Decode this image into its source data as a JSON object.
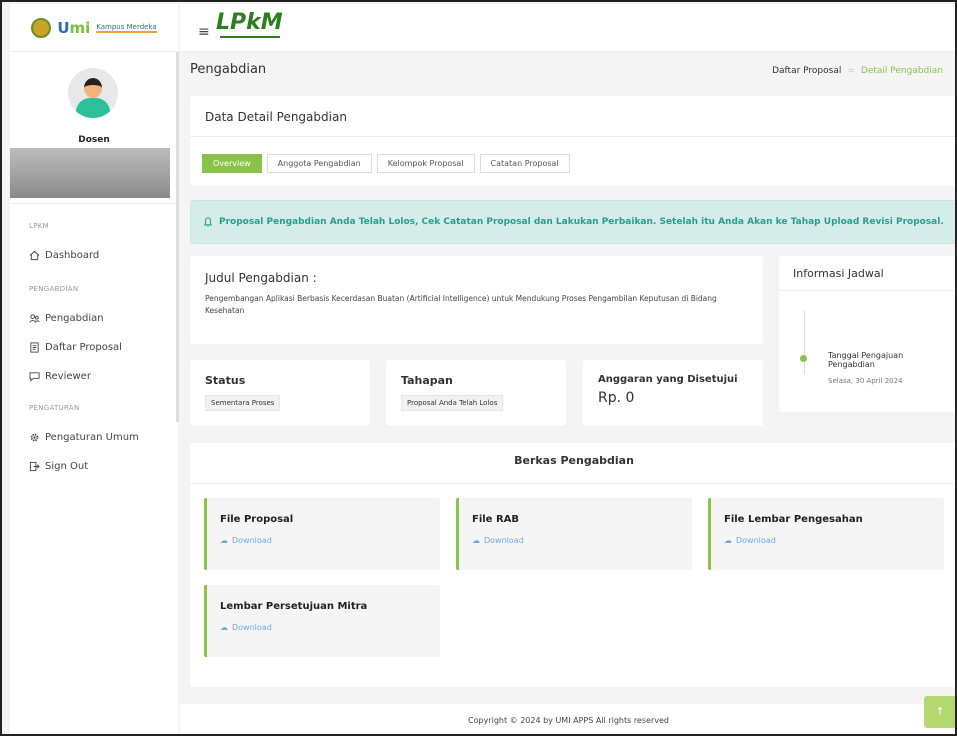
{
  "sidebar": {
    "logo_text_u": "U",
    "logo_text_mi": "mi",
    "logo_sub": "Kampus Merdeka",
    "role": "Dosen",
    "sections": [
      {
        "title": "LPKM",
        "items": [
          {
            "label": "Dashboard",
            "icon": "home-icon"
          }
        ]
      },
      {
        "title": "PENGABDIAN",
        "items": [
          {
            "label": "Pengabdian",
            "icon": "people-icon"
          },
          {
            "label": "Daftar Proposal",
            "icon": "document-icon"
          },
          {
            "label": "Reviewer",
            "icon": "chat-icon"
          }
        ]
      },
      {
        "title": "PENGATURAN",
        "items": [
          {
            "label": "Pengaturan Umum",
            "icon": "gear-icon"
          },
          {
            "label": "Sign Out",
            "icon": "sign-out-icon"
          }
        ]
      }
    ]
  },
  "header": {
    "brand": "LPkM",
    "menu_icon": "≡"
  },
  "page": {
    "title": "Pengabdian",
    "breadcrumb": {
      "parent": "Daftar Proposal",
      "separator": "=",
      "current": "Detail Pengabdian"
    }
  },
  "detail": {
    "card_title": "Data Detail Pengabdian",
    "tabs": [
      "Overview",
      "Anggota Pengabdian",
      "Kelompok Proposal",
      "Catatan Proposal"
    ]
  },
  "alert": {
    "text": "Proposal Pengabdian Anda Telah Lolos, Cek Catatan Proposal dan Lakukan Perbaikan. Setelah itu Anda Akan ke Tahap Upload Revisi Proposal."
  },
  "judul": {
    "label": "Judul Pengabdian :",
    "text": "Pengembangan Aplikasi Berbasis Kecerdasan Buatan (Artificial Intelligence) untuk Mendukung Proses Pengambilan Keputusan di Bidang Kesehatan"
  },
  "jadwal": {
    "title": "Informasi Jadwal",
    "event": "Tanggal Pengajuan Pengabdian",
    "date": "Selasa, 30 April 2024"
  },
  "status": {
    "label": "Status",
    "value": "Sementara Proses"
  },
  "tahapan": {
    "label": "Tahapan",
    "value": "Proposal Anda Telah Lolos"
  },
  "anggaran": {
    "label": "Anggaran yang Disetujui",
    "value": "Rp. 0"
  },
  "berkas": {
    "title": "Berkas Pengabdian",
    "download_label": "Download",
    "files": [
      "File Proposal",
      "File RAB",
      "File Lembar Pengesahan",
      "Lembar Persetujuan Mitra"
    ]
  },
  "footer": {
    "text": "Copyright © 2024 by UMI APPS All rights reserved",
    "top_icon": "↑"
  },
  "colors": {
    "accent": "#8bc34a",
    "alert_bg": "#d4ede8",
    "alert_text": "#2a9d8f",
    "link": "#6fa8dc"
  }
}
